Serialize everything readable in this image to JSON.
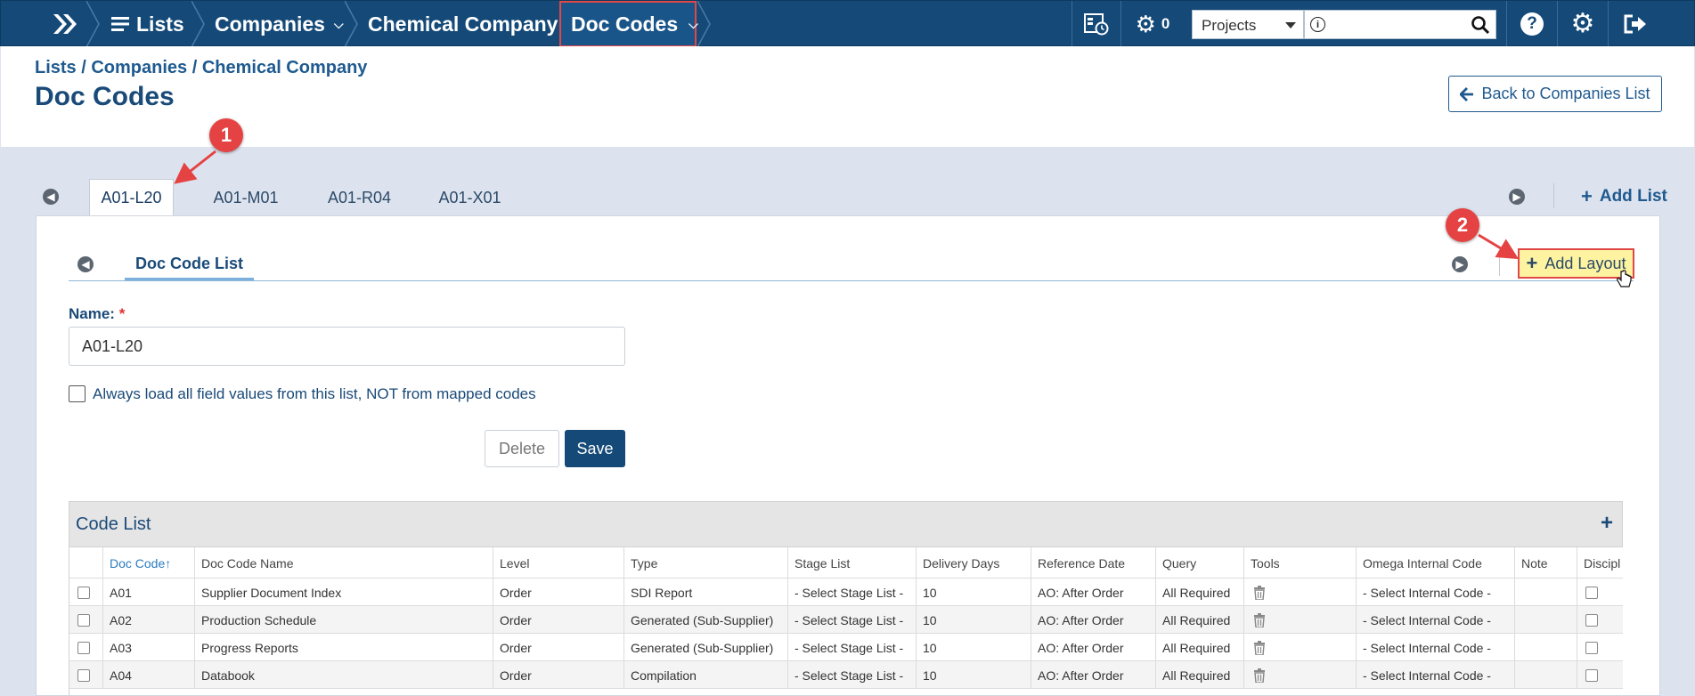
{
  "nav": {
    "lists": "Lists",
    "companies": "Companies",
    "company": "Chemical Company",
    "doc_codes": "Doc Codes",
    "jobs_count": "0",
    "project_select": "Projects",
    "search_placeholder": ""
  },
  "header": {
    "breadcrumb": "Lists / Companies / Chemical Company",
    "title": "Doc Codes",
    "back_button": "Back to Companies List"
  },
  "list_tabs": [
    "A01-L20",
    "A01-M01",
    "A01-R04",
    "A01-X01"
  ],
  "add_list": "Add List",
  "layout_tabs": [
    "Doc Code List"
  ],
  "add_layout": "Add Layout",
  "form": {
    "name_label": "Name:",
    "name_required": "*",
    "name_value": "A01-L20",
    "always_load_label": "Always load all field values from this list, NOT from mapped codes",
    "delete": "Delete",
    "save": "Save"
  },
  "code_list": {
    "title": "Code List",
    "columns": [
      "Doc Code",
      "Doc Code Name",
      "Level",
      "Type",
      "Stage List",
      "Delivery Days",
      "Reference Date",
      "Query",
      "Tools",
      "Omega Internal Code",
      "Note",
      "Discipl"
    ],
    "sort_indicator": "↑",
    "rows": [
      {
        "code": "A01",
        "name": "Supplier Document Index",
        "level": "Order",
        "type": "SDI Report",
        "stage": "- Select Stage List -",
        "days": "10",
        "ref": "AO: After Order",
        "query": "All Required",
        "omega": "- Select Internal Code -"
      },
      {
        "code": "A02",
        "name": "Production Schedule",
        "level": "Order",
        "type": "Generated (Sub-Supplier)",
        "stage": "- Select Stage List -",
        "days": "10",
        "ref": "AO: After Order",
        "query": "All Required",
        "omega": "- Select Internal Code -"
      },
      {
        "code": "A03",
        "name": "Progress Reports",
        "level": "Order",
        "type": "Generated (Sub-Supplier)",
        "stage": "- Select Stage List -",
        "days": "10",
        "ref": "AO: After Order",
        "query": "All Required",
        "omega": "- Select Internal Code -"
      },
      {
        "code": "A04",
        "name": "Databook",
        "level": "Order",
        "type": "Compilation",
        "stage": "- Select Stage List -",
        "days": "10",
        "ref": "AO: After Order",
        "query": "All Required",
        "omega": "- Select Internal Code -"
      }
    ]
  },
  "callouts": [
    "1",
    "2"
  ],
  "colors": {
    "topbar": "#154a78",
    "active_highlight": "#e04848",
    "add_layout_bg": "#fdf3a1",
    "callout": "#e54343"
  },
  "icons": [
    "home-chevrons-icon",
    "list-icon",
    "chevron-down-icon",
    "schedule-icon",
    "gears-icon",
    "info-icon",
    "search-icon",
    "help-icon",
    "settings-icon",
    "logout-icon",
    "arrow-left-icon",
    "plus-icon",
    "circle-arrow-left-icon",
    "circle-arrow-right-icon",
    "trash-icon"
  ]
}
